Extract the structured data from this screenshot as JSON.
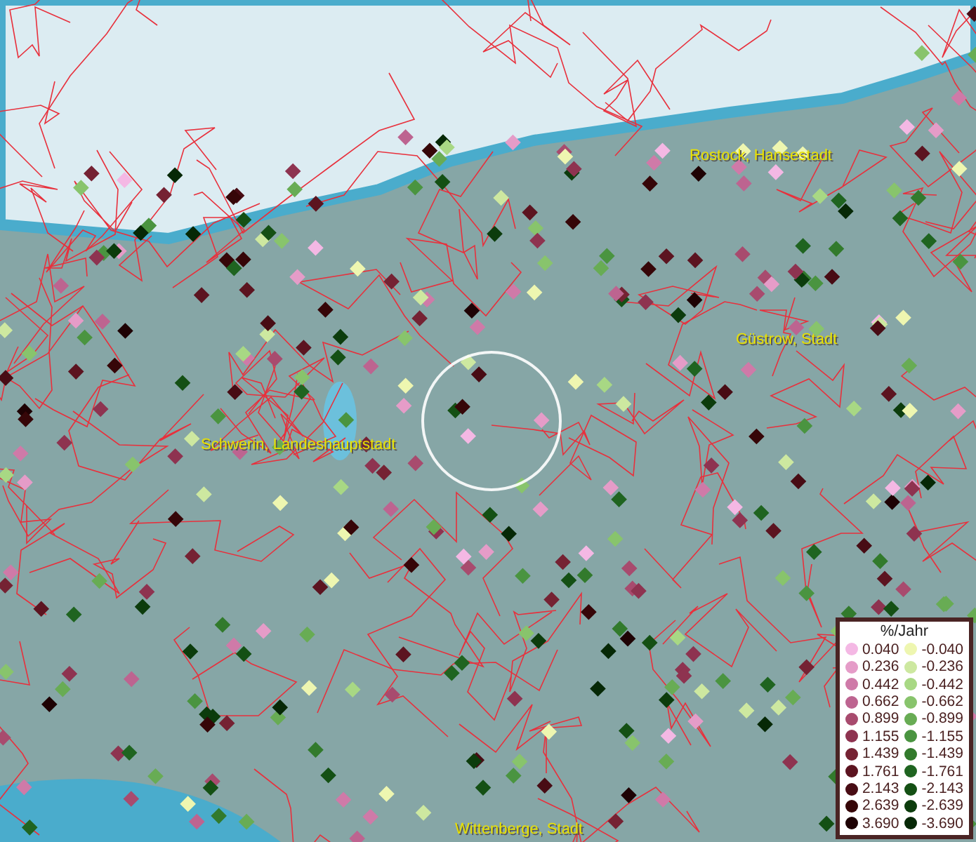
{
  "map": {
    "places": [
      "Rostock, Hansestadt",
      "Güstrow, Stadt",
      "Schwerin, Landeshauptstadt",
      "Wittenberge, Stadt"
    ]
  },
  "legend": {
    "title": "%/Jahr",
    "positive": [
      {
        "value": "0.040",
        "color": "#f4b8e4"
      },
      {
        "value": "0.236",
        "color": "#e59cc8"
      },
      {
        "value": "0.442",
        "color": "#cf7aa8"
      },
      {
        "value": "0.662",
        "color": "#bd6490"
      },
      {
        "value": "0.899",
        "color": "#a84b6e"
      },
      {
        "value": "1.155",
        "color": "#8e3350"
      },
      {
        "value": "1.439",
        "color": "#752233"
      },
      {
        "value": "1.761",
        "color": "#5c1420"
      },
      {
        "value": "2.143",
        "color": "#480c14"
      },
      {
        "value": "2.639",
        "color": "#360608"
      },
      {
        "value": "3.690",
        "color": "#1e0204"
      }
    ],
    "negative": [
      {
        "value": "-0.040",
        "color": "#eef6b0"
      },
      {
        "value": "-0.236",
        "color": "#cde8a0"
      },
      {
        "value": "-0.442",
        "color": "#a8d884"
      },
      {
        "value": "-0.662",
        "color": "#88c46c"
      },
      {
        "value": "-0.899",
        "color": "#68ac54"
      },
      {
        "value": "-1.155",
        "color": "#4a9440"
      },
      {
        "value": "-1.439",
        "color": "#327a2c"
      },
      {
        "value": "-1.761",
        "color": "#1f6420"
      },
      {
        "value": "-2.143",
        "color": "#145014"
      },
      {
        "value": "-2.639",
        "color": "#0c3c0c"
      },
      {
        "value": "-3.690",
        "color": "#062806"
      }
    ]
  }
}
